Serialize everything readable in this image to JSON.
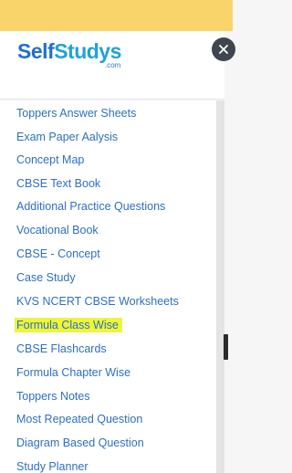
{
  "brand": {
    "name_part1": "Self",
    "name_part2": "Studys",
    "domain_suffix": ".com"
  },
  "close_icon": "close-icon",
  "menu": {
    "items": [
      {
        "label": "Toppers Answer Sheets"
      },
      {
        "label": "Exam Paper Aalysis"
      },
      {
        "label": "Concept Map"
      },
      {
        "label": "CBSE Text Book"
      },
      {
        "label": "Additional Practice Questions"
      },
      {
        "label": "Vocational Book"
      },
      {
        "label": "CBSE - Concept"
      },
      {
        "label": "Case Study"
      },
      {
        "label": "KVS NCERT CBSE Worksheets"
      },
      {
        "label": "Formula Class Wise"
      },
      {
        "label": "CBSE Flashcards"
      },
      {
        "label": "Formula Chapter Wise"
      },
      {
        "label": "Toppers Notes"
      },
      {
        "label": "Most Repeated Question"
      },
      {
        "label": "Diagram Based Question"
      },
      {
        "label": "Study Planner"
      }
    ]
  },
  "colors": {
    "header_bar": "#f9d46b",
    "link": "#2d6fc4",
    "highlight": "#eef53a"
  }
}
